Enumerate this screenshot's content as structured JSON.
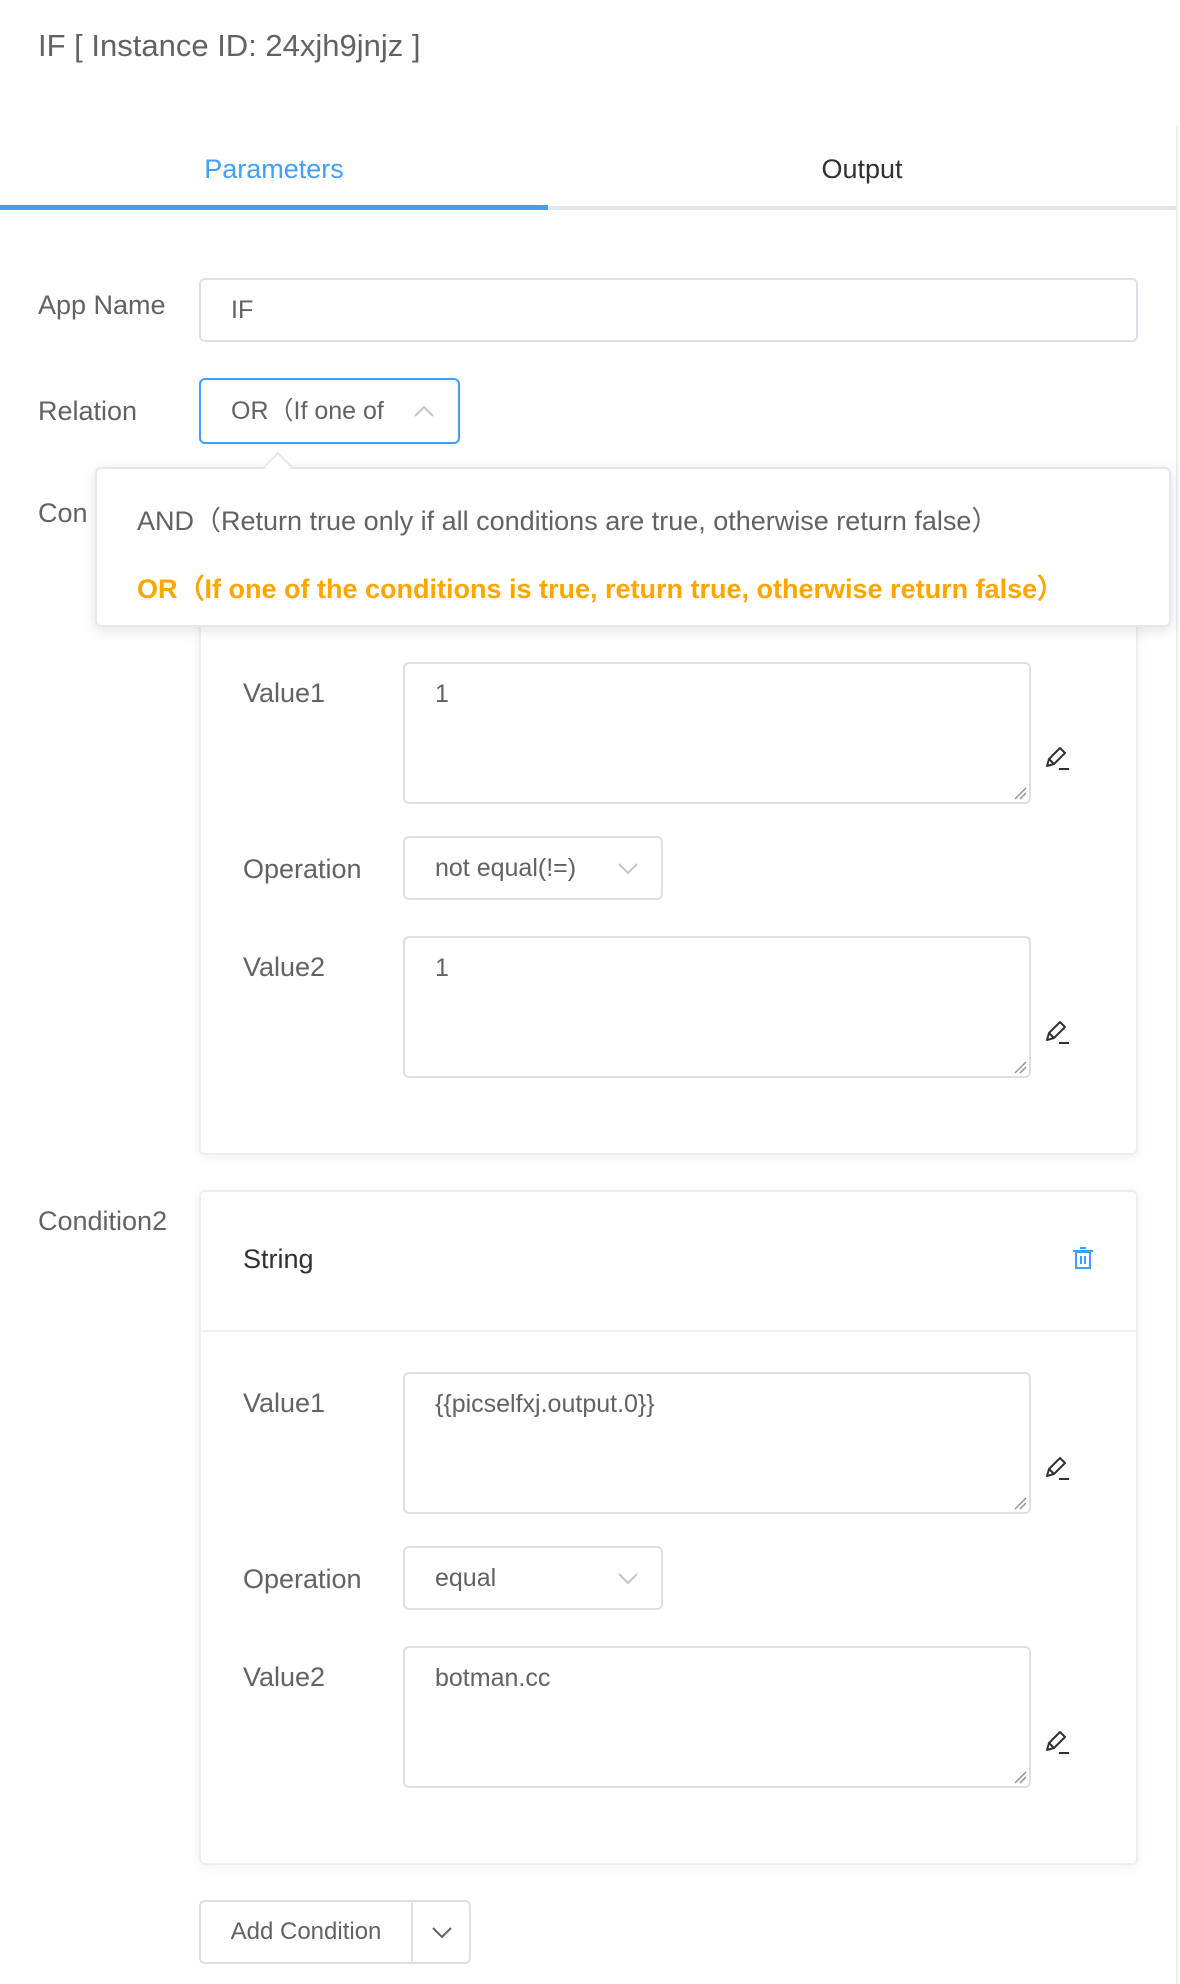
{
  "header": {
    "title": "IF [ Instance ID: 24xjh9jnjz ]"
  },
  "tabs": [
    {
      "label": "Parameters",
      "active": true
    },
    {
      "label": "Output",
      "active": false
    }
  ],
  "form": {
    "app_name_label": "App Name",
    "app_name_value": "IF",
    "relation_label": "Relation",
    "relation_value": "OR（If one of",
    "condition1_label_partial": "Con"
  },
  "relation_dropdown": {
    "options": [
      {
        "label": "AND（Return true only if all conditions are true, otherwise return false）",
        "selected": false
      },
      {
        "label": "OR（If one of the conditions is true, return true, otherwise return false）",
        "selected": true
      }
    ]
  },
  "conditions": [
    {
      "value1_label": "Value1",
      "value1": "1",
      "operation_label": "Operation",
      "operation": "not equal(!=)",
      "value2_label": "Value2",
      "value2": "1"
    },
    {
      "label": "Condition2",
      "type": "String",
      "value1_label": "Value1",
      "value1": "{{picselfxj.output.0}}",
      "operation_label": "Operation",
      "operation": "equal",
      "value2_label": "Value2",
      "value2": "botman.cc"
    }
  ],
  "actions": {
    "add_condition_label": "Add Condition"
  },
  "colors": {
    "accent": "#409eff",
    "selected_option": "#ffa500",
    "text": "#606266",
    "border": "#dcdfe6"
  },
  "icons": [
    "pencil-edit-icon",
    "trash-icon",
    "chevron-down-icon",
    "chevron-up-icon",
    "resize-grip-icon"
  ]
}
